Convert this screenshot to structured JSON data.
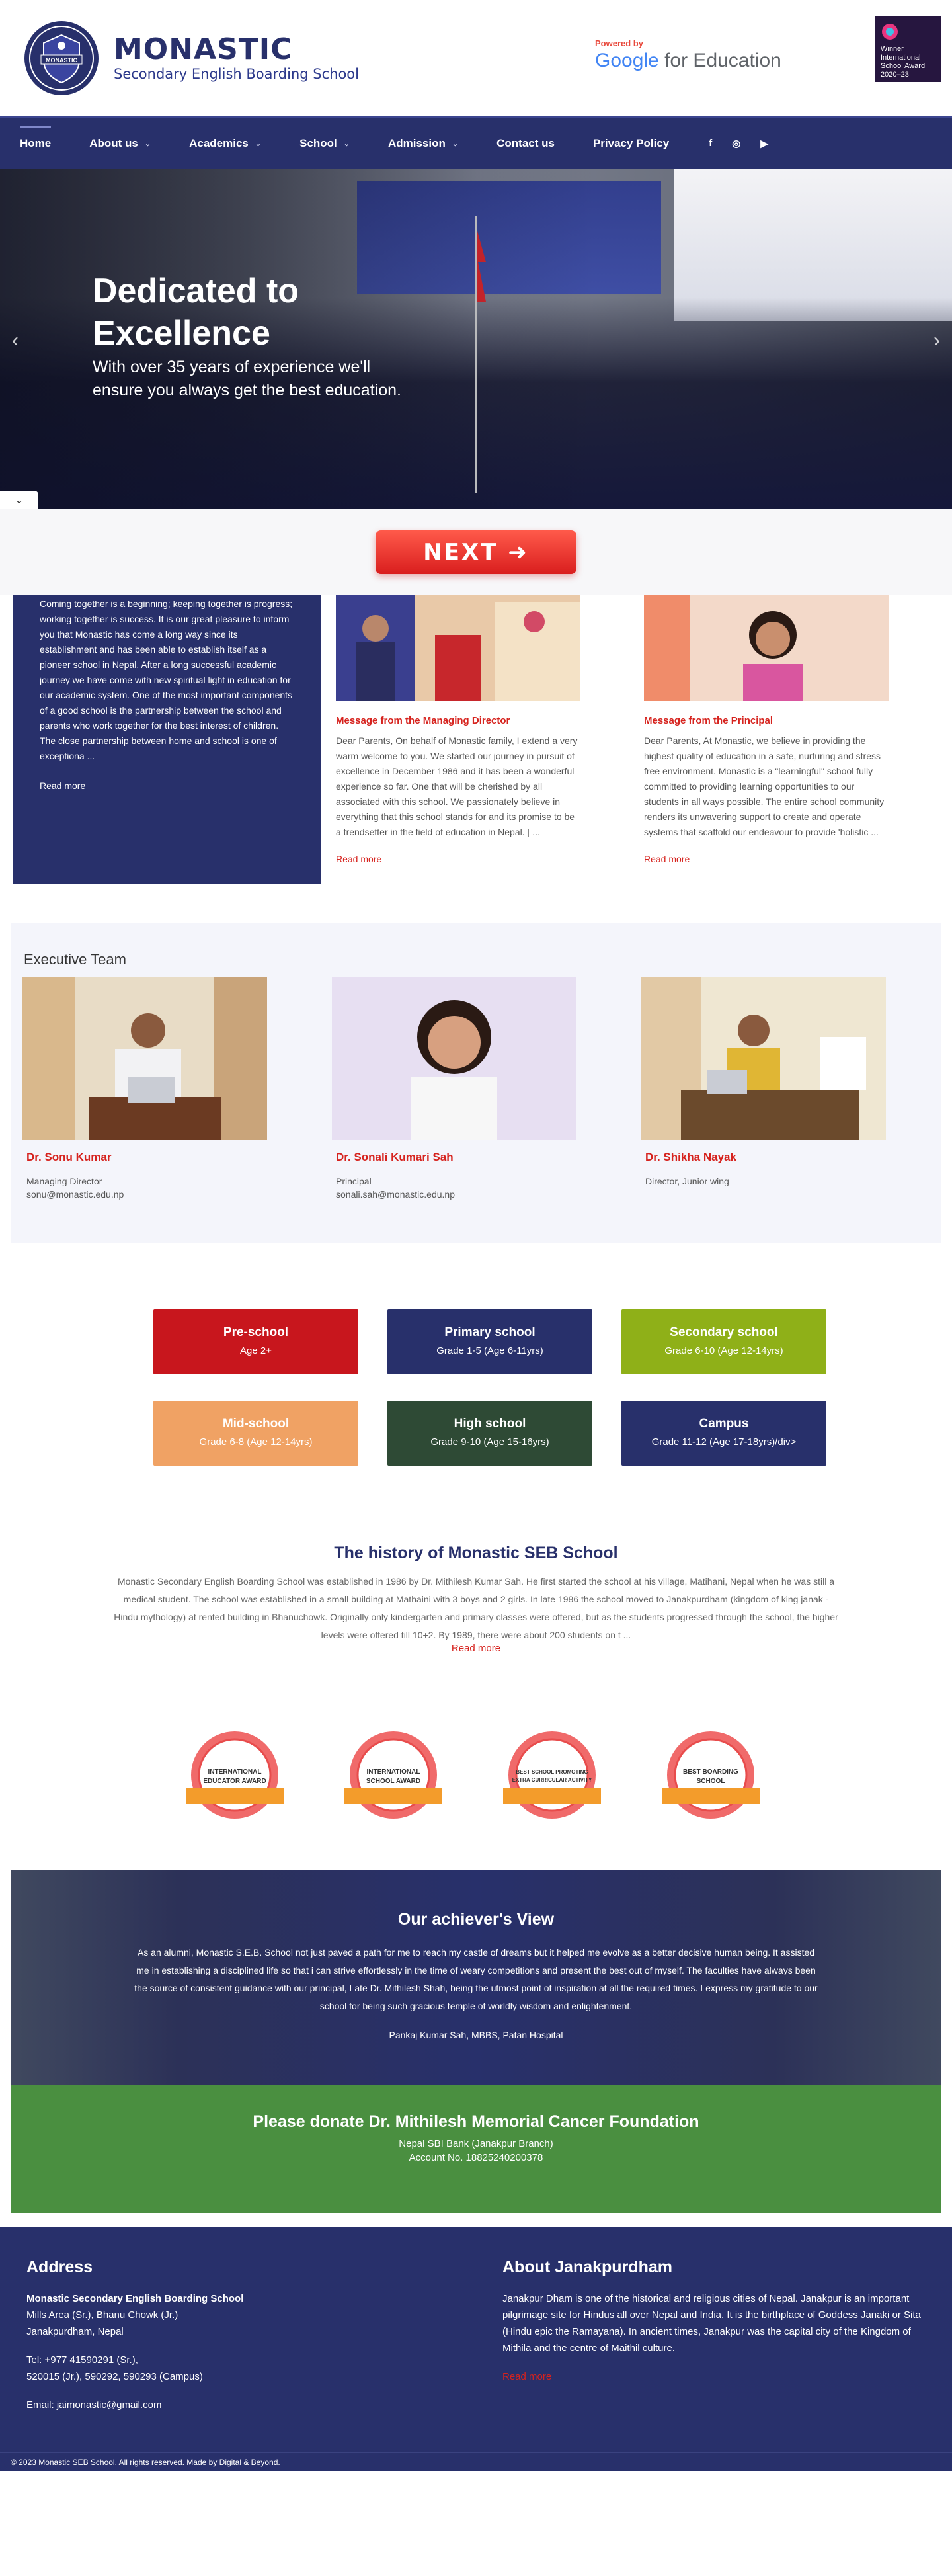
{
  "header": {
    "brand_name": "MONASTIC",
    "brand_sub": "Secondary English Boarding School",
    "logo_text": "MONASTIC",
    "gfe_powered": "Powered by",
    "gfe_google": "Google",
    "gfe_suffix": " for Education",
    "award_line1": "Winner",
    "award_line2": "International School Award",
    "award_line3": "2020–23"
  },
  "nav": {
    "items": [
      {
        "label": "Home"
      },
      {
        "label": "About us",
        "has_caret": true
      },
      {
        "label": "Academics",
        "has_caret": true
      },
      {
        "label": "School",
        "has_caret": true
      },
      {
        "label": "Admission",
        "has_caret": true
      },
      {
        "label": "Contact us"
      },
      {
        "label": "Privacy Policy"
      }
    ],
    "social": [
      "facebook-icon",
      "instagram-icon",
      "youtube-icon"
    ]
  },
  "hero": {
    "title": "Dedicated to Excellence",
    "subtitle": "With over 35 years of experience we'll ensure you always get the best education."
  },
  "next_button": "NEXT ➜",
  "messages": {
    "main_text": "Coming together is a beginning; keeping together is progress; working together is success. It is our great pleasure to inform you that Monastic has come a long way since its establishment and has been able to establish itself as a pioneer school in Nepal. After a long successful academic journey we have come with new spiritual light in education for our academic system. One of the most important components of a good school is the partnership between the school and parents who work together for the best interest of children. The close partnership between home and school is one of exceptiona ...",
    "main_read_more": "Read more",
    "cards": [
      {
        "title": "Message from the Managing Director",
        "body": "Dear Parents, On behalf of Monastic family, I extend a very warm welcome to you. We started our journey in pursuit of excellence in December 1986 and it has been a wonderful experience so far. One that will be cherished by all associated with this school. We passionately believe in everything that this school stands for and its promise to be a trendsetter in the field of education in Nepal. [ ...",
        "read_more": "Read more"
      },
      {
        "title": "Message from the Principal",
        "body": "Dear Parents, At Monastic, we believe in providing the highest quality of education in a safe, nurturing and stress free environment. Monastic is a \"learningful\" school fully committed to providing learning opportunities to our students in all ways possible. The entire school community renders its unwavering support to create and operate systems that scaffold our endeavour to provide 'holistic ...",
        "read_more": "Read more"
      }
    ]
  },
  "executive": {
    "title": "Executive Team",
    "members": [
      {
        "name": "Dr. Sonu Kumar",
        "role": "Managing Director",
        "email": "sonu@monastic.edu.np"
      },
      {
        "name": "Dr. Sonali Kumari Sah",
        "role": "Principal",
        "email": "sonali.sah@monastic.edu.np"
      },
      {
        "name": "Dr. Shikha Nayak",
        "role": "Director, Junior wing",
        "email": ""
      }
    ]
  },
  "levels": [
    {
      "title": "Pre-school",
      "sub": "Age 2+",
      "color": "#c8161d"
    },
    {
      "title": "Primary school",
      "sub": "Grade 1-5 (Age 6-11yrs)",
      "color": "#28306b"
    },
    {
      "title": "Secondary school",
      "sub": "Grade 6-10 (Age 12-14yrs)",
      "color": "#8fb018"
    },
    {
      "title": "Mid-school",
      "sub": "Grade 6-8 (Age 12-14yrs)",
      "color": "#f0a264"
    },
    {
      "title": "High school",
      "sub": "Grade 9-10 (Age 15-16yrs)",
      "color": "#2e4a35"
    },
    {
      "title": "Campus",
      "sub": "Grade 11-12 (Age 17-18yrs)/div>",
      "color": "#28306b"
    }
  ],
  "history": {
    "title": "The history of Monastic SEB School",
    "body": "Monastic Secondary English Boarding School was established in 1986 by Dr. Mithilesh Kumar Sah. He first started the school at his village, Matihani, Nepal when he was still a medical student. The school was established in a small building at Mathaini with 3 boys and 2 girls. In late 1986 the school moved to Janakpurdham (kingdom of king janak - Hindu mythology) at rented building in Bhanuchowk. Originally only kindergarten and primary classes were offered, but as the students progressed through the school, the higher levels were offered till 10+2. By 1989, there were about 200 students on t ...",
    "read_more": "Read more"
  },
  "badges": [
    {
      "line1": "INTERNATIONAL",
      "line2": "EDUCATOR AWARD"
    },
    {
      "line1": "INTERNATIONAL",
      "line2": "SCHOOL AWARD"
    },
    {
      "line1": "BEST SCHOOL PROMOTING",
      "line2": "EXTRA CURRICULAR ACTIVITY"
    },
    {
      "line1": "BEST BOARDING",
      "line2": "SCHOOL"
    }
  ],
  "achiever": {
    "title": "Our achiever's View",
    "body": "As an alumni, Monastic S.E.B. School not just paved a path for me to reach my castle of dreams but it helped me evolve as a better decisive human being. It assisted me in establishing a disciplined life so that i can strive effortlessly in the time of weary competitions and present the best out of myself. The faculties have always been the source of consistent guidance with our principal, Late Dr. Mithilesh Shah, being the utmost point of inspiration at all the required times. I express my gratitude to our school for being such gracious temple of worldly wisdom and enlightenment.",
    "author": "Pankaj Kumar Sah, MBBS, Patan Hospital"
  },
  "donate": {
    "title": "Please donate Dr. Mithilesh Memorial Cancer Foundation",
    "bank": "Nepal SBI Bank (Janakpur Branch)",
    "account": "Account No. 18825240200378"
  },
  "footer": {
    "address_title": "Address",
    "school": "Monastic Secondary English Boarding School",
    "addr1": "Mills Area (Sr.), Bhanu Chowk (Jr.)",
    "addr2": "Janakpurdham, Nepal",
    "tel1": "Tel: +977 41590291 (Sr.),",
    "tel2": "520015 (Jr.), 590292, 590293 (Campus)",
    "email": "Email: jaimonastic@gmail.com",
    "about_title": "About Janakpurdham",
    "about_body": "Janakpur Dham is one of the historical and religious cities of Nepal. Janakpur is an important pilgrimage site for Hindus all over Nepal and India. It is the birthplace of Goddess Janaki or Sita (Hindu epic the Ramayana). In ancient times, Janakpur was the capital city of the Kingdom of Mithila and the centre of Maithil culture.",
    "about_read_more": "Read more",
    "copyright": "© 2023 Monastic SEB School. All rights reserved. Made by Digital & Beyond."
  }
}
